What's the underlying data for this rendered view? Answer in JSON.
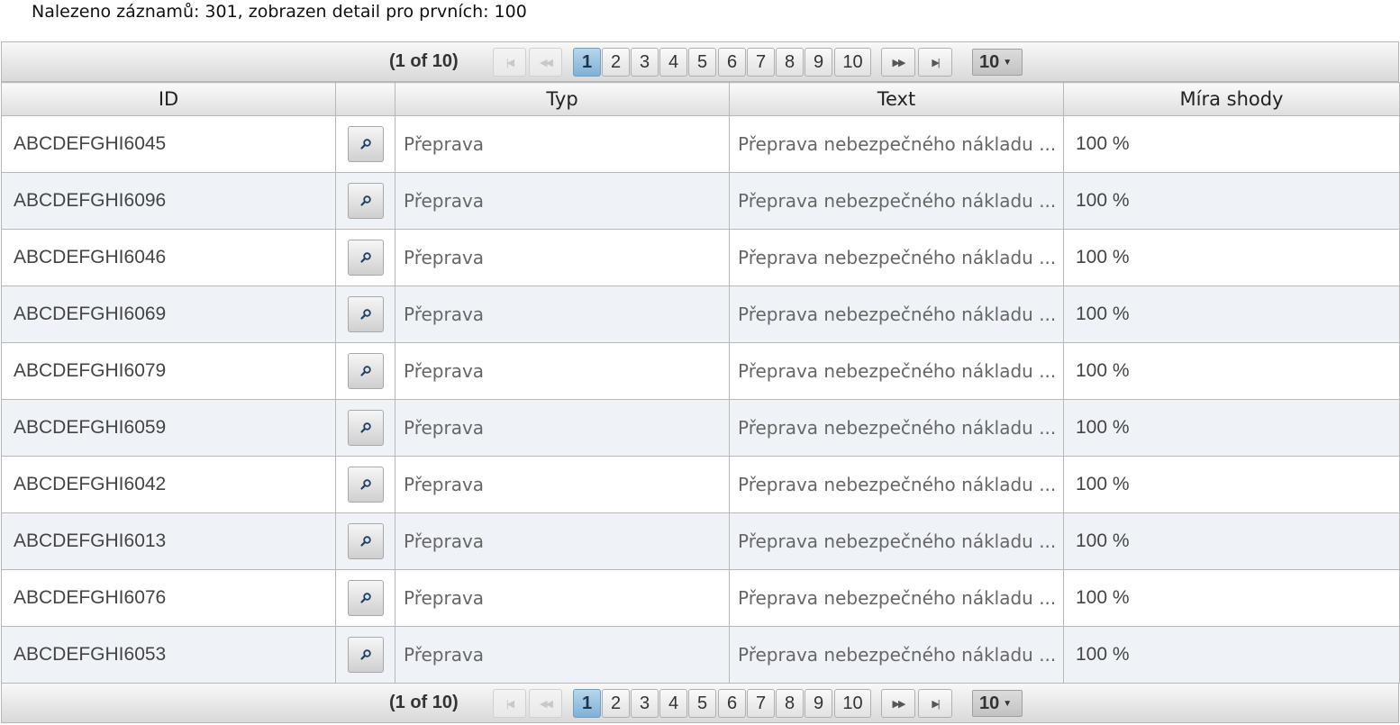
{
  "summary": {
    "label": "Nalezeno",
    "text": "záznamů: 301, zobrazen detail pro prvních: 100"
  },
  "paginator": {
    "count": "(1 of 10)",
    "first_icon": "first-page-icon",
    "prev_icon": "previous-page-icon",
    "next_icon": "next-page-icon",
    "last_icon": "last-page-icon",
    "pages": [
      "1",
      "2",
      "3",
      "4",
      "5",
      "6",
      "7",
      "8",
      "9",
      "10"
    ],
    "active_page": "1",
    "rows_per_page": "10"
  },
  "table": {
    "columns": [
      "ID",
      "",
      "Typ",
      "Text",
      "Míra shody"
    ],
    "detail_icon": "magnifier-icon",
    "rows": [
      {
        "id": "ABCDEFGHI6045",
        "typ": "Přeprava",
        "text": "Přeprava nebezpečného nákladu ...",
        "rate": "100 %"
      },
      {
        "id": "ABCDEFGHI6096",
        "typ": "Přeprava",
        "text": "Přeprava nebezpečného nákladu ...",
        "rate": "100 %"
      },
      {
        "id": "ABCDEFGHI6046",
        "typ": "Přeprava",
        "text": "Přeprava nebezpečného nákladu ...",
        "rate": "100 %"
      },
      {
        "id": "ABCDEFGHI6069",
        "typ": "Přeprava",
        "text": "Přeprava nebezpečného nákladu ...",
        "rate": "100 %"
      },
      {
        "id": "ABCDEFGHI6079",
        "typ": "Přeprava",
        "text": "Přeprava nebezpečného nákladu ...",
        "rate": "100 %"
      },
      {
        "id": "ABCDEFGHI6059",
        "typ": "Přeprava",
        "text": "Přeprava nebezpečného nákladu ...",
        "rate": "100 %"
      },
      {
        "id": "ABCDEFGHI6042",
        "typ": "Přeprava",
        "text": "Přeprava nebezpečného nákladu ...",
        "rate": "100 %"
      },
      {
        "id": "ABCDEFGHI6013",
        "typ": "Přeprava",
        "text": "Přeprava nebezpečného nákladu ...",
        "rate": "100 %"
      },
      {
        "id": "ABCDEFGHI6076",
        "typ": "Přeprava",
        "text": "Přeprava nebezpečného nákladu ...",
        "rate": "100 %"
      },
      {
        "id": "ABCDEFGHI6053",
        "typ": "Přeprava",
        "text": "Přeprava nebezpečného nákladu ...",
        "rate": "100 %"
      }
    ]
  }
}
